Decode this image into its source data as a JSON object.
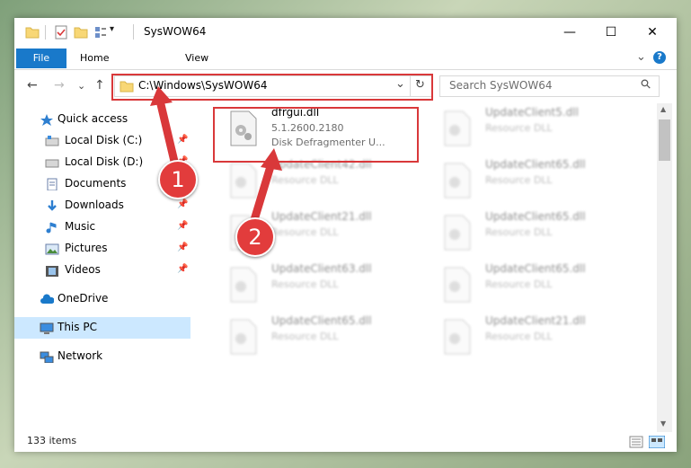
{
  "window": {
    "title": "SysWOW64",
    "minimize": "—",
    "maximize": "☐",
    "close": "✕"
  },
  "ribbon": {
    "tabs": [
      "File",
      "Home",
      "View"
    ],
    "expand": "⌄",
    "help": "?"
  },
  "nav": {
    "back": "←",
    "forward": "→",
    "recent": "⌄",
    "up": "↑",
    "address": "C:\\Windows\\SysWOW64",
    "address_dropdown": "⌄",
    "refresh": "↻",
    "search_placeholder": "Search SysWOW64",
    "search_icon": "⚲"
  },
  "sidebar": {
    "items": [
      {
        "label": "Quick access",
        "icon": "star-icon",
        "pinned": false
      },
      {
        "label": "Local Disk (C:)",
        "icon": "drive-icon",
        "pinned": true
      },
      {
        "label": "Local Disk (D:)",
        "icon": "drive-icon",
        "pinned": true
      },
      {
        "label": "Documents",
        "icon": "documents-icon",
        "pinned": true
      },
      {
        "label": "Downloads",
        "icon": "download-icon",
        "pinned": true
      },
      {
        "label": "Music",
        "icon": "music-icon",
        "pinned": true
      },
      {
        "label": "Pictures",
        "icon": "pictures-icon",
        "pinned": true
      },
      {
        "label": "Videos",
        "icon": "videos-icon",
        "pinned": true
      },
      {
        "label": "OneDrive",
        "icon": "cloud-icon",
        "pinned": false
      },
      {
        "label": "This PC",
        "icon": "computer-icon",
        "pinned": false,
        "selected": true
      },
      {
        "label": "Network",
        "icon": "network-icon",
        "pinned": false
      }
    ],
    "pin_glyph": "📌"
  },
  "files": {
    "highlighted": {
      "name": "dfrgui.dll",
      "version": "5.1.2600.2180",
      "description": "Disk Defragmenter U..."
    },
    "left_column": [
      {
        "name": "UpdateClient42.dll",
        "type": "Resource DLL"
      },
      {
        "name": "UpdateClient21.dll",
        "type": "Resource DLL"
      },
      {
        "name": "UpdateClient63.dll",
        "type": "Resource DLL"
      },
      {
        "name": "UpdateClient65.dll",
        "type": "Resource DLL"
      }
    ],
    "right_column": [
      {
        "name": "UpdateClient5.dll",
        "type": "Resource DLL"
      },
      {
        "name": "UpdateClient65.dll",
        "type": "Resource DLL"
      },
      {
        "name": "UpdateClient65.dll",
        "type": "Resource DLL"
      },
      {
        "name": "UpdateClient65.dll",
        "type": "Resource DLL"
      },
      {
        "name": "UpdateClient21.dll",
        "type": "Resource DLL"
      }
    ]
  },
  "status": {
    "item_count": "133 items"
  },
  "annotations": {
    "step1": "1",
    "step2": "2",
    "color": "#d9383a"
  },
  "colors": {
    "accent": "#1979ca",
    "selection": "#cce8ff"
  }
}
